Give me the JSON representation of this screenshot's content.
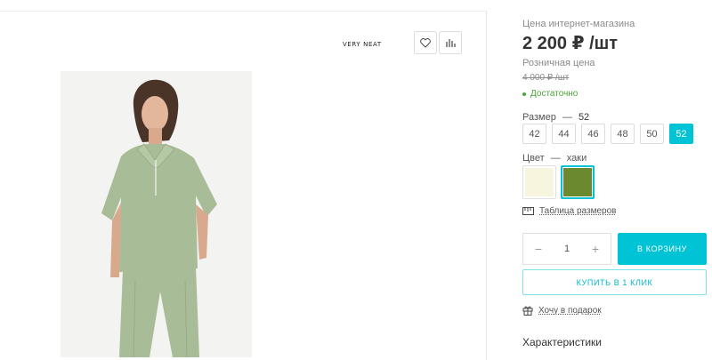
{
  "product": {
    "brand": "VERY NEAT"
  },
  "icons": {
    "favorite": "heart-icon",
    "compare": "bar-chart-icon",
    "size_table": "ruler-icon",
    "gift": "gift-icon"
  },
  "pricing": {
    "online_label": "Цена интернет-магазина",
    "online_price": "2 200 ₽ /шт",
    "retail_label": "Розничная цена",
    "retail_price": "4 000 ₽ /шт",
    "stock_status": "Достаточно",
    "stock_color": "#4aa636"
  },
  "size": {
    "label": "Размер",
    "separator": "—",
    "selected": "52",
    "options": [
      "42",
      "44",
      "46",
      "48",
      "50",
      "52"
    ]
  },
  "color": {
    "label": "Цвет",
    "separator": "—",
    "selected": "хаки",
    "swatches": [
      "#f7f5dd",
      "#6b8a2f"
    ]
  },
  "size_table_link": "Таблица размеров",
  "quantity": {
    "minus": "−",
    "value": "1",
    "plus": "+"
  },
  "actions": {
    "cart": "В КОРЗИНУ",
    "one_click": "КУПИТЬ В 1 КЛИК",
    "gift": "Хочу в подарок",
    "accent_color": "#00c4d6"
  },
  "specs_title": "Характеристики"
}
